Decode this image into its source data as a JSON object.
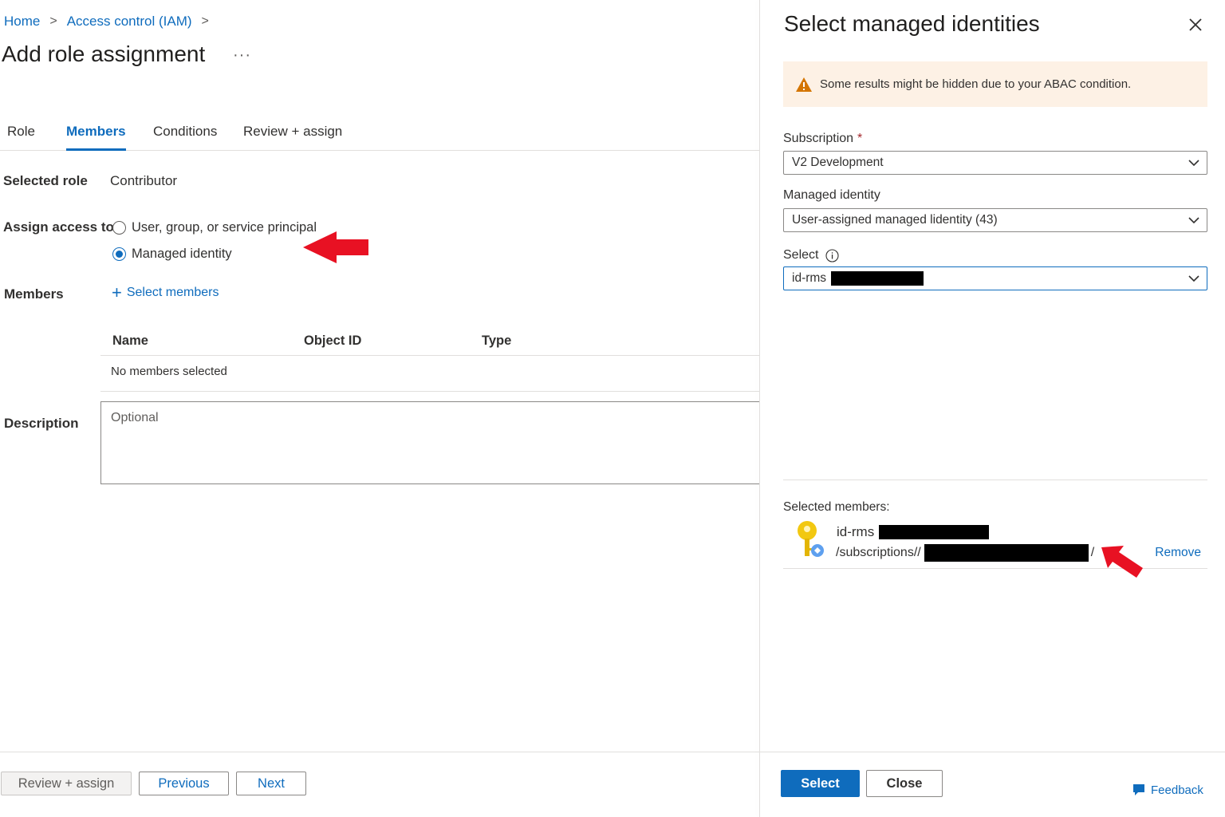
{
  "breadcrumb": {
    "items": [
      "Home",
      "Access control (IAM)"
    ],
    "separator": ">"
  },
  "page": {
    "title": "Add role assignment",
    "more": "···"
  },
  "tabs": [
    {
      "label": "Role",
      "active": false
    },
    {
      "label": "Members",
      "active": true
    },
    {
      "label": "Conditions",
      "active": false
    },
    {
      "label": "Review + assign",
      "active": false
    }
  ],
  "form": {
    "selected_role_label": "Selected role",
    "selected_role_value": "Contributor",
    "assign_access_label": "Assign access to",
    "assign_options": [
      {
        "label": "User, group, or service principal",
        "checked": false
      },
      {
        "label": "Managed identity",
        "checked": true
      }
    ],
    "members_label": "Members",
    "select_members_link": "Select members",
    "table": {
      "columns": [
        "Name",
        "Object ID",
        "Type"
      ],
      "empty_text": "No members selected"
    },
    "description_label": "Description",
    "description_placeholder": "Optional"
  },
  "footer": {
    "review_assign": "Review + assign",
    "previous": "Previous",
    "next": "Next"
  },
  "panel": {
    "title": "Select managed identities",
    "warning": "Some results might be hidden due to your ABAC condition.",
    "subscription_label": "Subscription",
    "required_mark": "*",
    "subscription_value": "V2 Development",
    "managed_identity_label": "Managed identity",
    "managed_identity_value": "User-assigned managed lidentity (43)",
    "select_label": "Select",
    "select_value": "id-rms",
    "selected_members_label": "Selected members:",
    "selected_member": {
      "name": "id-rms",
      "path_prefix": "/subscriptions//",
      "path_suffix": "/",
      "remove": "Remove"
    },
    "select_button": "Select",
    "close_button": "Close",
    "feedback": "Feedback"
  },
  "colors": {
    "accent": "#0f6cbd",
    "warning_bg": "#fdf1e5",
    "warning_icon": "#d47500",
    "annotation_arrow": "#e81123"
  }
}
